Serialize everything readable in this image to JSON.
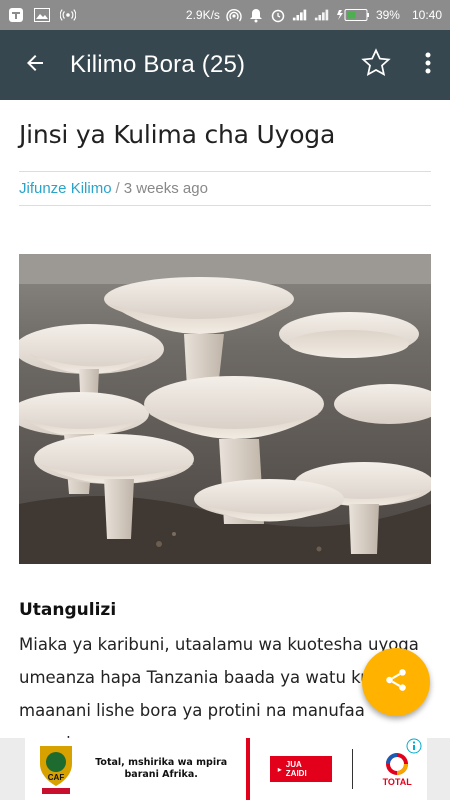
{
  "status_bar": {
    "speed": "2.9K/s",
    "battery": "39%",
    "time": "10:40"
  },
  "app_bar": {
    "title": "Kilimo Bora (25)"
  },
  "article": {
    "title": "Jinsi ya Kulima cha Uyoga",
    "author": "Jifunze Kilimo",
    "separator": "/",
    "age": "3 weeks ago"
  },
  "section": {
    "heading": "Utangulizi",
    "body": "Miaka ya karibuni, utaalamu wa kuotesha uyoga umeanza hapa Tanzania baada ya watu kutilia maanani lishe bora ya protini na manufaa mengine"
  },
  "ad": {
    "headline": "Total, mshirika wa mpira barani Afrika.",
    "cta": "JUA ZAIDI",
    "brand": "TOTAL",
    "badge": "CAF"
  },
  "colors": {
    "app_bar": "#37474f",
    "accent": "#ffb300",
    "link": "#2aa4c9"
  }
}
